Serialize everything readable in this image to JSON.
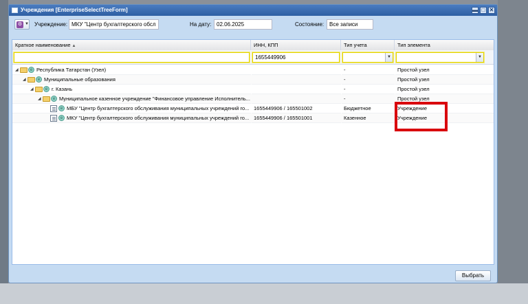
{
  "window": {
    "title": "Учреждения [EnterpriseSelectTreeForm]"
  },
  "toolbar": {
    "institution_label": "Учреждение:",
    "institution_value": "МКУ \"Центр бухгалтерского обсл",
    "date_label": "На дату:",
    "date_value": "02.06.2025",
    "state_label": "Состояние:",
    "state_value": "Все записи"
  },
  "grid": {
    "columns": [
      "Краткое наименование",
      "ИНН, КПП",
      "Тип учета",
      "Тип элемента"
    ],
    "sort_indicator": "▲",
    "filters": {
      "name": "",
      "inn": "1655449906",
      "accounting_type": "",
      "element_type": ""
    },
    "rows": [
      {
        "name": "Республика Татарстан (Узел)",
        "inn": "",
        "accounting": "-",
        "element": "Простой узел",
        "kind": "folder",
        "expander": "◢"
      },
      {
        "name": "Муниципальные образования",
        "inn": "",
        "accounting": "-",
        "element": "Простой узел",
        "kind": "folder",
        "expander": "◢"
      },
      {
        "name": "г. Казань",
        "inn": "",
        "accounting": "-",
        "element": "Простой узел",
        "kind": "folder",
        "expander": "◢"
      },
      {
        "name": "Муниципальное казенное учреждение \"Финансовое управление Исполнитель...",
        "inn": "",
        "accounting": "-",
        "element": "Простой узел",
        "kind": "folder",
        "expander": "◢"
      },
      {
        "name": "МБУ \"Центр бухгалтерского обслуживания муниципальных учреждений го...",
        "inn": "1655449906 / 165501002",
        "accounting": "Бюджетное",
        "element": "Учреждение",
        "kind": "doc",
        "expander": ""
      },
      {
        "name": "МКУ \"Центр бухгалтерского обслуживания муниципальных учреждений го...",
        "inn": "1655449906 / 165501001",
        "accounting": "Казенное",
        "element": "Учреждение",
        "kind": "doc",
        "expander": ""
      }
    ]
  },
  "footer": {
    "select_button": "Выбрать"
  },
  "icons": {
    "window_minimize": "▬",
    "window_maximize": "□",
    "window_close": "✕",
    "dropdown": "▼"
  },
  "colors": {
    "highlight_box": "#d9000d",
    "filter_border": "#e2d200"
  }
}
